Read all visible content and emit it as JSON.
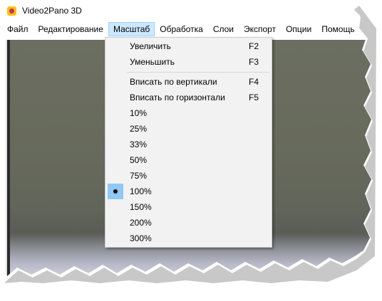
{
  "window": {
    "title": "Video2Pano 3D",
    "icon": "app-icon"
  },
  "menubar": {
    "items": [
      {
        "label": "Файл"
      },
      {
        "label": "Редактирование"
      },
      {
        "label": "Масштаб"
      },
      {
        "label": "Обработка"
      },
      {
        "label": "Слои"
      },
      {
        "label": "Экспорт"
      },
      {
        "label": "Опции"
      },
      {
        "label": "Помощь"
      }
    ],
    "active": "Масштаб"
  },
  "zoom_menu": {
    "items": [
      {
        "label": "Увеличить",
        "shortcut": "F2"
      },
      {
        "label": "Уменьшить",
        "shortcut": "F3"
      },
      {
        "label": "Вписать по вертикали",
        "shortcut": "F4"
      },
      {
        "label": "Вписать по горизонтали",
        "shortcut": "F5"
      },
      {
        "label": "10%"
      },
      {
        "label": "25%"
      },
      {
        "label": "33%"
      },
      {
        "label": "50%"
      },
      {
        "label": "75%"
      },
      {
        "label": "100%",
        "selected": true
      },
      {
        "label": "150%"
      },
      {
        "label": "200%"
      },
      {
        "label": "300%"
      }
    ]
  },
  "colors": {
    "menu_highlight": "#cce8ff",
    "selected_mark": "#90c8f6",
    "app_icon_bg": "#f5c400",
    "app_icon_fg": "#d6246e"
  }
}
